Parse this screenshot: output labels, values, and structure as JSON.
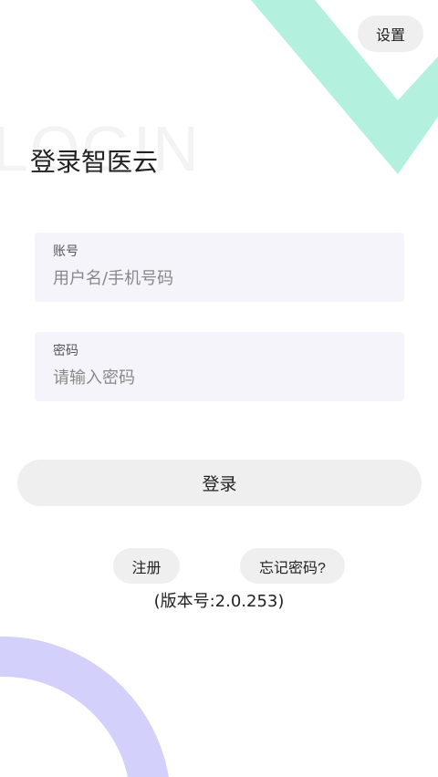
{
  "header": {
    "settings_label": "设置"
  },
  "background": {
    "watermark": "LOGIN",
    "accent_color": "#b3f0dd",
    "arc_color": "#d3d1fb"
  },
  "title": "登录智医云",
  "form": {
    "account": {
      "label": "账号",
      "placeholder": "用户名/手机号码",
      "value": ""
    },
    "password": {
      "label": "密码",
      "placeholder": "请输入密码",
      "value": ""
    }
  },
  "login_label": "登录",
  "links": {
    "register": "注册",
    "forgot": "忘记密码?"
  },
  "version": "(版本号:2.0.253)"
}
